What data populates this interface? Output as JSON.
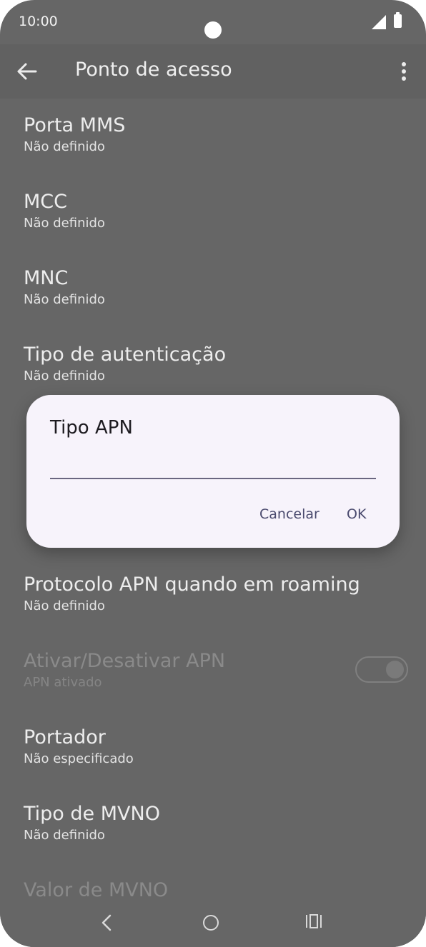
{
  "status_bar": {
    "time": "10:00"
  },
  "app_bar": {
    "title": "Ponto de acesso"
  },
  "settings": [
    {
      "title": "Porta MMS",
      "subtitle": "Não definido"
    },
    {
      "title": "MCC",
      "subtitle": "Não definido"
    },
    {
      "title": "MNC",
      "subtitle": "Não definido"
    },
    {
      "title": "Tipo de autenticação",
      "subtitle": "Não definido"
    },
    {
      "title": "Protocolo APN quando em roaming",
      "subtitle": "Não definido"
    },
    {
      "title": "Ativar/Desativar APN",
      "subtitle": "APN ativado",
      "toggle_on": true
    },
    {
      "title": "Portador",
      "subtitle": "Não especificado"
    },
    {
      "title": "Tipo de MVNO",
      "subtitle": "Não definido"
    },
    {
      "title": "Valor de MVNO"
    }
  ],
  "dialog": {
    "title": "Tipo APN",
    "input_value": "",
    "cancel_label": "Cancelar",
    "ok_label": "OK"
  },
  "colors": {
    "scrim_background": "#666666",
    "dialog_background": "#f7f3fb",
    "accent": "#4a4a6e"
  }
}
